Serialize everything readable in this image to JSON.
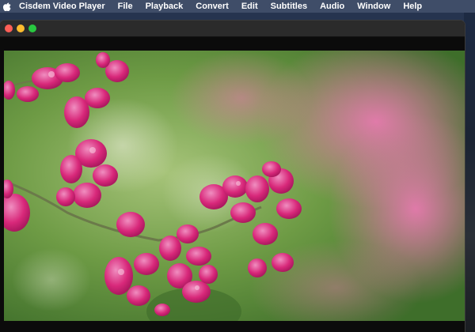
{
  "menubar": {
    "app_name": "Cisdem Video Player",
    "menus": [
      "File",
      "Playback",
      "Convert",
      "Edit",
      "Subtitles",
      "Audio",
      "Window",
      "Help"
    ]
  },
  "window": {
    "traffic_lights": {
      "close": "#fe5f57",
      "minimize": "#febc2e",
      "zoom": "#28c840"
    }
  },
  "video": {
    "frame_subject": "pink flowers on branch, blurred green background",
    "accent_colors": {
      "flower": "#d8287a",
      "background": "#6f9a3e"
    }
  }
}
